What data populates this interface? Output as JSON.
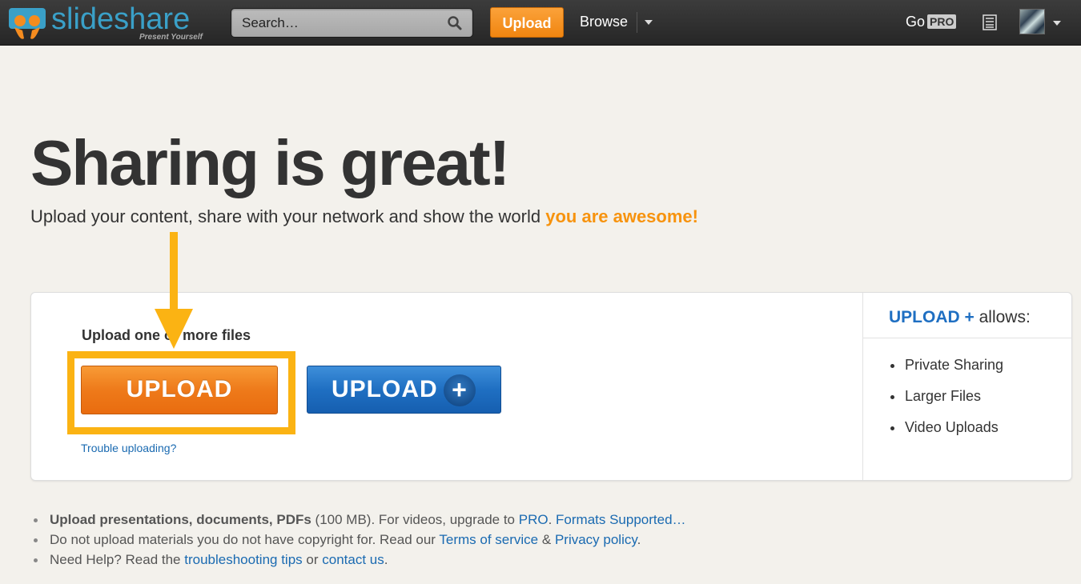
{
  "topbar": {
    "logo_word_1": "slide",
    "logo_word_2": "share",
    "logo_tagline": "Present Yourself",
    "search_placeholder": "Search…",
    "upload_label": "Upload",
    "browse_label": "Browse",
    "gopro_label": "Go",
    "pro_badge": "PRO"
  },
  "hero": {
    "title": "Sharing is great!",
    "subtitle_prefix": "Upload your content, share with your network and show the world ",
    "subtitle_highlight": "you are awesome!"
  },
  "panel": {
    "heading": "Upload one or more files",
    "upload_button": "UPLOAD",
    "upload_plus_button": "UPLOAD",
    "plus_symbol": "+",
    "trouble_link": "Trouble uploading?",
    "side_title_bold": "UPLOAD +",
    "side_title_rest": " allows:",
    "features": [
      "Private Sharing",
      "Larger Files",
      "Video Uploads"
    ]
  },
  "notes": {
    "n1_bold": "Upload presentations, documents, PDFs",
    "n1_text": " (100 MB). For videos, upgrade to ",
    "n1_link_pro": "PRO",
    "n1_dot": ". ",
    "n1_link_formats": "Formats Supported…",
    "n2_text": "Do not upload materials you do not have copyright for. Read our ",
    "n2_link_terms": "Terms of service",
    "n2_amp": " & ",
    "n2_link_privacy": "Privacy policy",
    "n2_dot": ".",
    "n3_text": "Need Help? Read the ",
    "n3_link_tips": "troubleshooting tips",
    "n3_or": " or ",
    "n3_link_contact": "contact us",
    "n3_dot": "."
  },
  "colors": {
    "accent_orange": "#f7930e",
    "accent_blue": "#1f6fc2",
    "highlight_yellow": "#fbb313"
  },
  "icons": {
    "search": "search-icon",
    "list": "list-icon",
    "caret": "chevron-down-icon"
  }
}
